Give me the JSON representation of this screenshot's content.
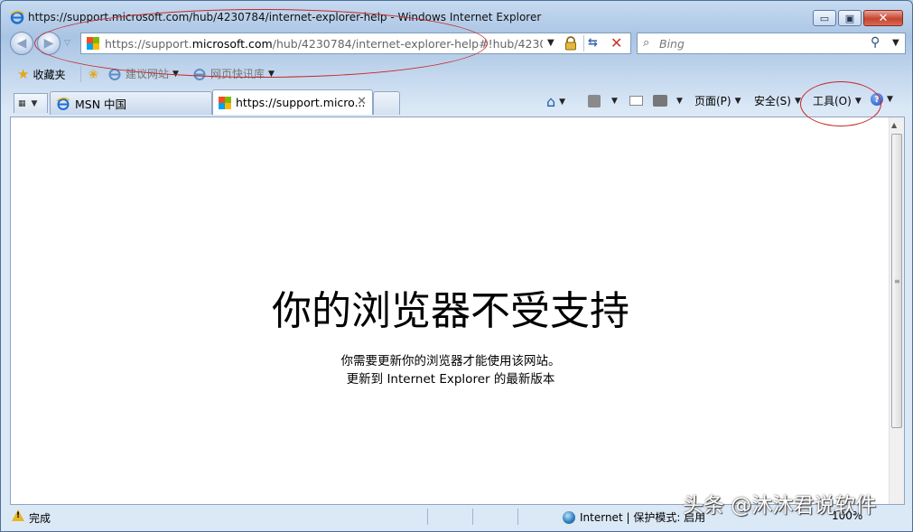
{
  "window": {
    "title": "https://support.microsoft.com/hub/4230784/internet-explorer-help - Windows Internet Explorer",
    "minimize_glyph": "▭",
    "maximize_glyph": "▣",
    "close_glyph": "✕"
  },
  "navigation": {
    "back_glyph": "◀",
    "forward_glyph": "▶",
    "recent_dd": "▽",
    "address_prefix": "https://support.",
    "address_domain": "microsoft.com",
    "address_suffix": "/hub/4230784/internet-explorer-help#!hub/4230784/i",
    "search_placeholder": "Bing"
  },
  "favorites_bar": {
    "favorites_label": "收藏夹",
    "suggested_sites": "建议网站",
    "web_slice_gallery": "网页快讯库"
  },
  "tabs": [
    {
      "label": "MSN 中国"
    },
    {
      "label": "https://support.micro..."
    }
  ],
  "command_bar": {
    "page": "页面(P)",
    "safety": "安全(S)",
    "tools": "工具(O)",
    "help_glyph": "?"
  },
  "page_content": {
    "heading": "你的浏览器不受支持",
    "message_line1": "你需要更新你的浏览器才能使用该网站。",
    "message_line2": "更新到 Internet Explorer 的最新版本"
  },
  "status_bar": {
    "status": "完成",
    "zone": "Internet | 保护模式: 启用",
    "zoom": "100%"
  },
  "watermark": "头条 @沐沐君说软件",
  "colors": {
    "annotation": "#c62828",
    "ms_red": "#f25022",
    "ms_green": "#7fba00",
    "ms_blue": "#00a4ef",
    "ms_yellow": "#ffb900"
  }
}
